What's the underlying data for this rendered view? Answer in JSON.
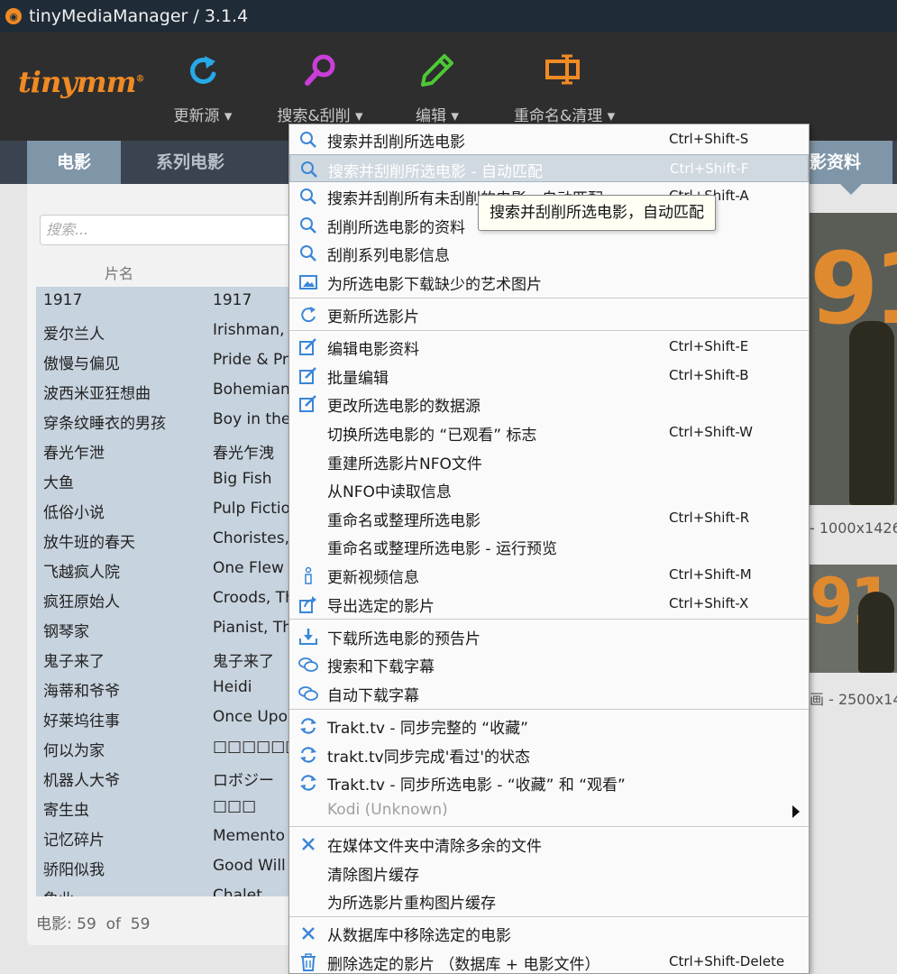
{
  "window": {
    "title": "tinyMediaManager / 3.1.4"
  },
  "logo": {
    "text": "tinymm",
    "mark": "®"
  },
  "toolbar": [
    {
      "label": "更新源 ▾",
      "icon": "refresh-icon",
      "color": "#27a9e8"
    },
    {
      "label": "搜索&刮削 ▾",
      "icon": "magnifier-icon",
      "color": "#c83fd8"
    },
    {
      "label": "编辑 ▾",
      "icon": "pencil-icon",
      "color": "#4ec836"
    },
    {
      "label": "重命名&清理 ▾",
      "icon": "rename-icon",
      "color": "#f08a24"
    }
  ],
  "tabs": {
    "movies": "电影",
    "tvshows": "系列电影",
    "details": "影资料"
  },
  "search": {
    "placeholder": "搜索..."
  },
  "list": {
    "header": "片名",
    "rows": [
      {
        "title": "1917",
        "original": "1917"
      },
      {
        "title": "爱尔兰人",
        "original": "Irishman, The"
      },
      {
        "title": "傲慢与偏见",
        "original": "Pride & Prejudice"
      },
      {
        "title": "波西米亚狂想曲",
        "original": "Bohemian Rhapsody"
      },
      {
        "title": "穿条纹睡衣的男孩",
        "original": "Boy in the Striped Pyjamas, The"
      },
      {
        "title": "春光乍泄",
        "original": "春光乍洩"
      },
      {
        "title": "大鱼",
        "original": "Big Fish"
      },
      {
        "title": "低俗小说",
        "original": "Pulp Fiction"
      },
      {
        "title": "放牛班的春天",
        "original": "Choristes, Les"
      },
      {
        "title": "飞越疯人院",
        "original": "One Flew Over the Cuckoo's Nest"
      },
      {
        "title": "疯狂原始人",
        "original": "Croods, The"
      },
      {
        "title": "钢琴家",
        "original": "Pianist, The"
      },
      {
        "title": "鬼子来了",
        "original": "鬼子来了"
      },
      {
        "title": "海蒂和爷爷",
        "original": "Heidi"
      },
      {
        "title": "好莱坞往事",
        "original": "Once Upon a Time in Hollywood"
      },
      {
        "title": "何以为家",
        "original": "□□□□□□□"
      },
      {
        "title": "机器人大爷",
        "original": "ロボジー"
      },
      {
        "title": "寄生虫",
        "original": "□□□"
      },
      {
        "title": "记忆碎片",
        "original": "Memento"
      },
      {
        "title": "骄阳似我",
        "original": "Good Will Hunting"
      },
      {
        "title": "象业",
        "original": "Chalet"
      }
    ]
  },
  "status": {
    "label": "电影:",
    "shown": "59",
    "of": "of",
    "total": "59"
  },
  "details": {
    "res1": "- 1000x1426",
    "res2": "画 - 2500x14",
    "poster_text": "91"
  },
  "menu": {
    "items": [
      {
        "label": "搜索并刮削所选电影",
        "shortcut": "Ctrl+Shift-S",
        "icon": "search-icon"
      },
      {
        "label": "搜索并刮削所选电影 - 自动匹配",
        "shortcut": "Ctrl+Shift-F",
        "icon": "search-icon",
        "highlighted": true
      },
      {
        "label": "搜索并刮削所有未刮削的电影 - 自动匹配",
        "shortcut": "Ctrl+Shift-A",
        "icon": "search-icon"
      },
      {
        "label": "刮削所选电影的资料",
        "shortcut": "",
        "icon": "search-icon"
      },
      {
        "label": "刮削系列电影信息",
        "shortcut": "",
        "icon": "search-icon"
      },
      {
        "label": "为所选电影下载缺少的艺术图片",
        "shortcut": "",
        "icon": "image-icon",
        "sep_after": true
      },
      {
        "label": "更新所选影片",
        "shortcut": "",
        "icon": "refresh-icon",
        "sep_after": true
      },
      {
        "label": "编辑电影资料",
        "shortcut": "Ctrl+Shift-E",
        "icon": "edit-icon"
      },
      {
        "label": "批量编辑",
        "shortcut": "Ctrl+Shift-B",
        "icon": "edit-icon"
      },
      {
        "label": "更改所选电影的数据源",
        "shortcut": "",
        "icon": "edit-icon"
      },
      {
        "label": "切换所选电影的 “已观看” 标志",
        "shortcut": "Ctrl+Shift-W",
        "icon": ""
      },
      {
        "label": "重建所选影片NFO文件",
        "shortcut": "",
        "icon": ""
      },
      {
        "label": "从NFO中读取信息",
        "shortcut": "",
        "icon": ""
      },
      {
        "label": "重命名或整理所选电影",
        "shortcut": "Ctrl+Shift-R",
        "icon": ""
      },
      {
        "label": "重命名或整理所选电影 - 运行预览",
        "shortcut": "",
        "icon": ""
      },
      {
        "label": "更新视频信息",
        "shortcut": "Ctrl+Shift-M",
        "icon": "info-icon"
      },
      {
        "label": "导出选定的影片",
        "shortcut": "Ctrl+Shift-X",
        "icon": "export-icon",
        "sep_after": true
      },
      {
        "label": "下载所选电影的预告片",
        "shortcut": "",
        "icon": "download-icon"
      },
      {
        "label": "搜索和下载字幕",
        "shortcut": "",
        "icon": "subtitle-icon"
      },
      {
        "label": "自动下载字幕",
        "shortcut": "",
        "icon": "subtitle-icon",
        "sep_after": true
      },
      {
        "label": "Trakt.tv - 同步完整的 “收藏”",
        "shortcut": "",
        "icon": "sync-icon"
      },
      {
        "label": "trakt.tv同步完成'看过'的状态",
        "shortcut": "",
        "icon": "sync-icon"
      },
      {
        "label": "Trakt.tv - 同步所选电影 - “收藏” 和 “观看”",
        "shortcut": "",
        "icon": "sync-icon"
      },
      {
        "label": "Kodi (Unknown)",
        "shortcut": "",
        "icon": "",
        "disabled": true,
        "submenu": true,
        "sep_after": true
      },
      {
        "label": "在媒体文件夹中清除多余的文件",
        "shortcut": "",
        "icon": "close-icon"
      },
      {
        "label": "清除图片缓存",
        "shortcut": "",
        "icon": ""
      },
      {
        "label": "为所选影片重构图片缓存",
        "shortcut": "",
        "icon": "",
        "sep_after": true
      },
      {
        "label": "从数据库中移除选定的电影",
        "shortcut": "",
        "icon": "close-icon"
      },
      {
        "label": "删除选定的影片 （数据库 + 电影文件）",
        "shortcut": "Ctrl+Shift-Delete",
        "icon": "trash-icon"
      }
    ]
  },
  "tooltip": {
    "text": "搜索并刮削所选电影，自动匹配"
  }
}
